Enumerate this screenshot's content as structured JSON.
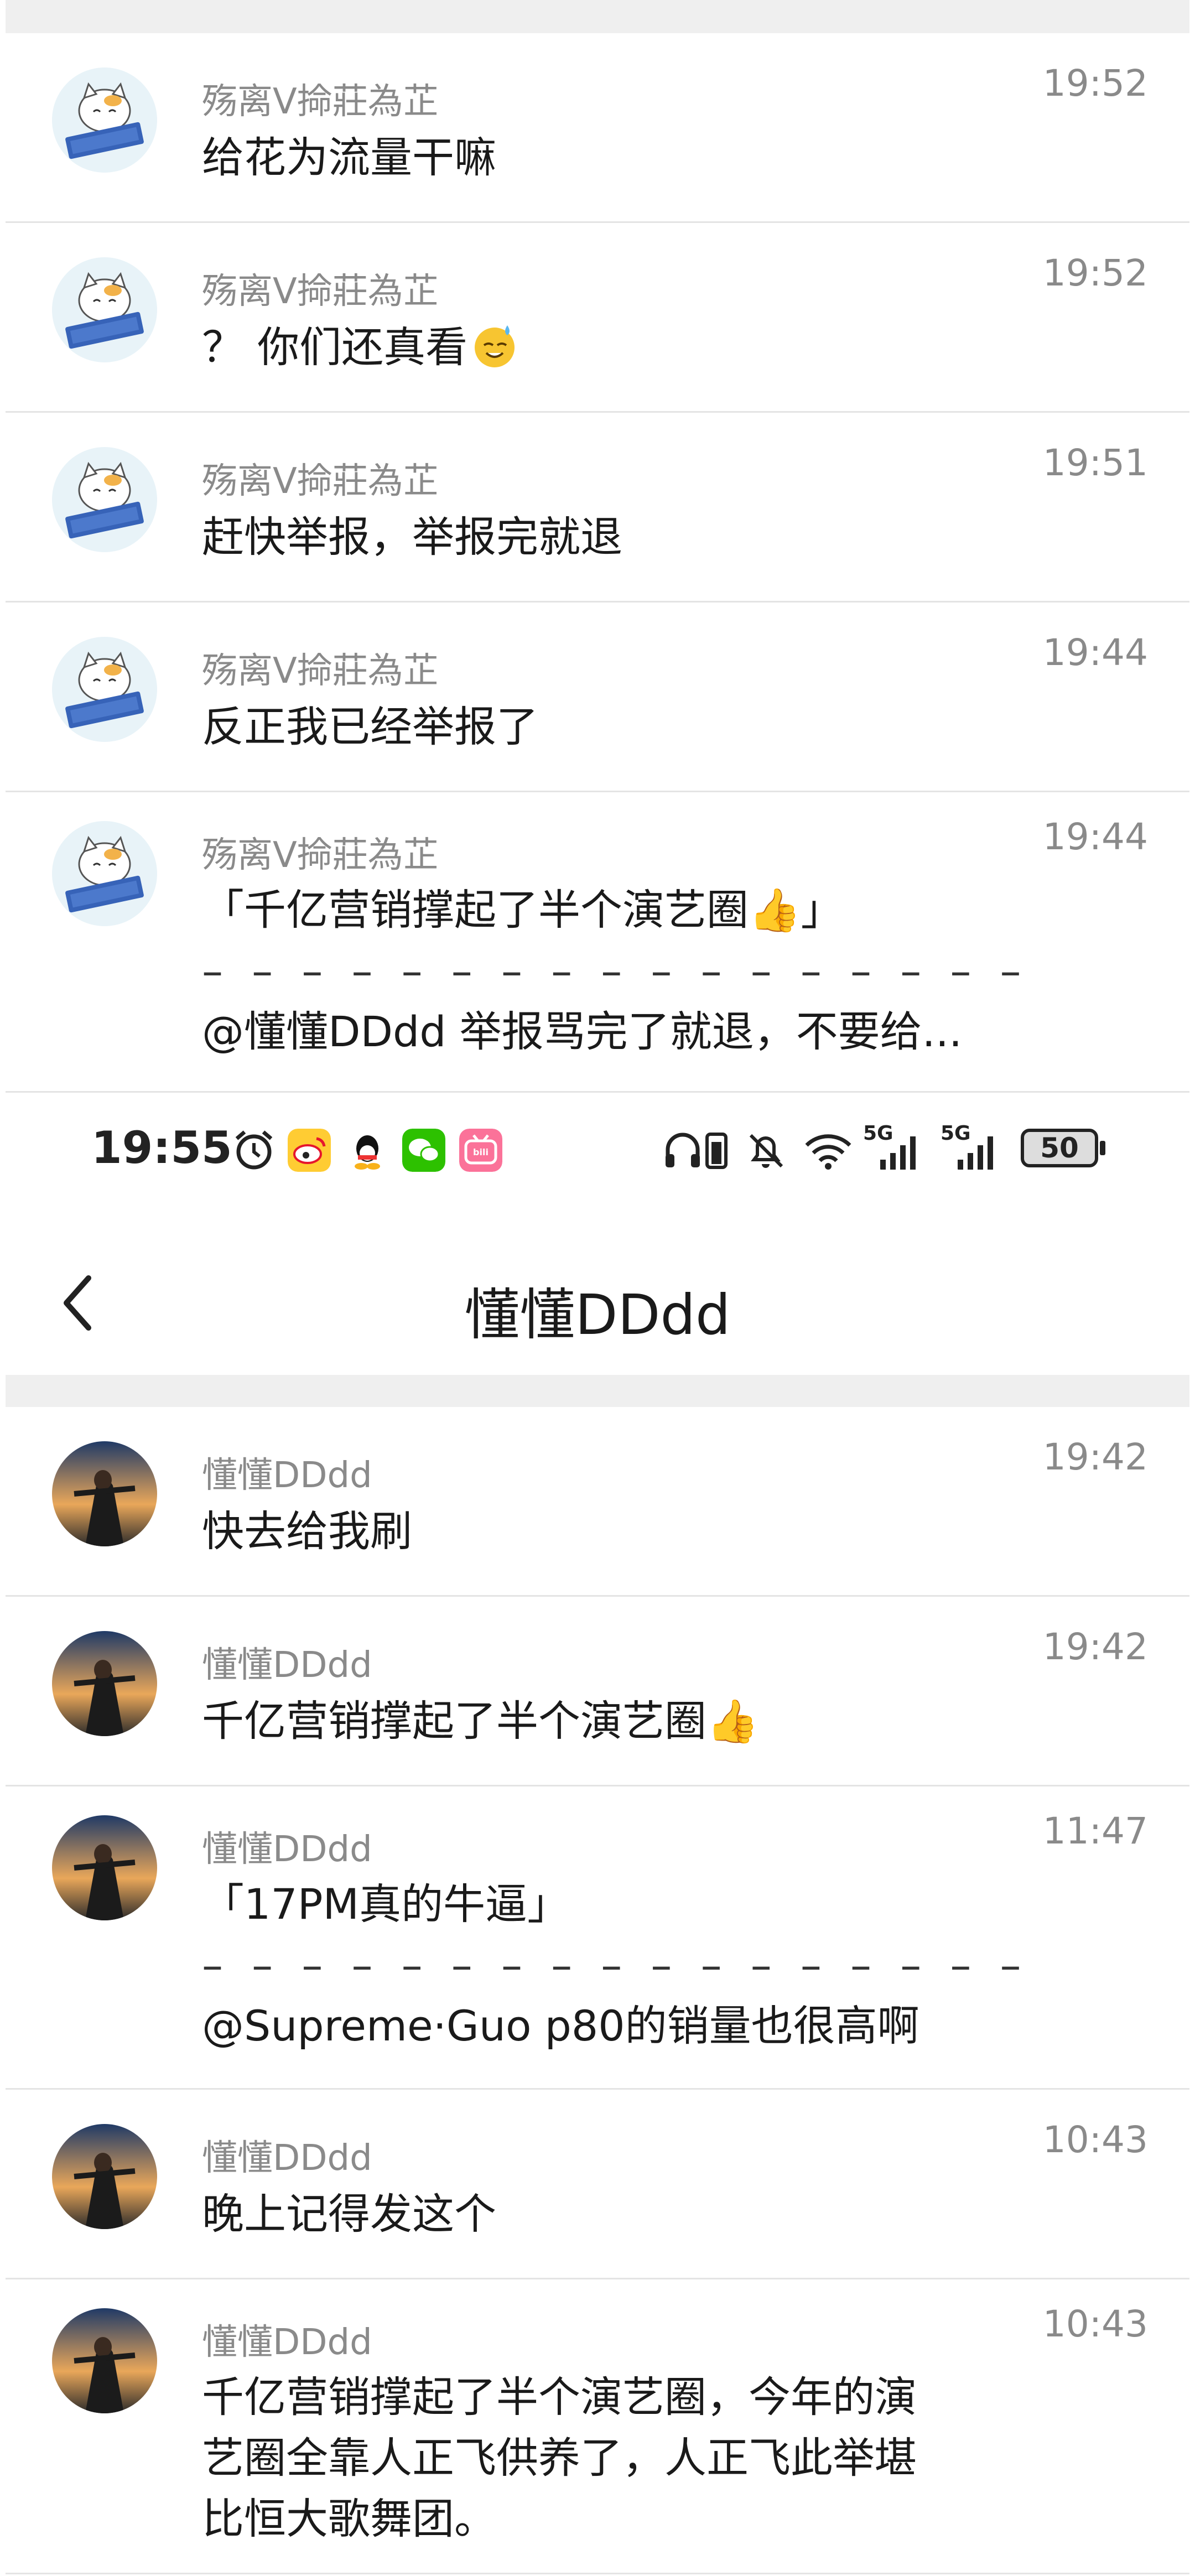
{
  "top_section": {
    "rows": [
      {
        "name": "殇离V掵莊為芷",
        "time": "19:52",
        "lines": [
          "给花为流量干嘛"
        ],
        "emoji": null
      },
      {
        "name": "殇离V掵莊為芷",
        "time": "19:52",
        "lines": [
          "？ 你们还真看"
        ],
        "emoji": "sweat-smile"
      },
      {
        "name": "殇离V掵莊為芷",
        "time": "19:51",
        "lines": [
          "赶快举报，举报完就退"
        ],
        "emoji": null
      },
      {
        "name": "殇离V掵莊為芷",
        "time": "19:44",
        "lines": [
          "反正我已经举报了"
        ],
        "emoji": null
      },
      {
        "name": "殇离V掵莊為芷",
        "time": "19:44",
        "quote": "「千亿营销撑起了半个演艺圈👍」",
        "dash": "– – – – – – – – – – – – – – – – –",
        "reply": "@懂懂DDdd 举报骂完了就退，不要给..."
      }
    ]
  },
  "status_bar": {
    "time": "19:55",
    "battery": "50",
    "network_1": "5G",
    "network_2": "5G"
  },
  "header": {
    "title": "懂懂DDdd",
    "back_label": "<"
  },
  "bottom_section": {
    "rows": [
      {
        "name": "懂懂DDdd",
        "time": "19:42",
        "lines": [
          "快去给我刷"
        ]
      },
      {
        "name": "懂懂DDdd",
        "time": "19:42",
        "lines": [
          "千亿营销撑起了半个演艺圈👍"
        ]
      },
      {
        "name": "懂懂DDdd",
        "time": "11:47",
        "quote": "「17PM真的牛逼」",
        "dash": "– – – – – – – – – – – – – – – – –",
        "reply": "@Supreme·Guo p80的销量也很高啊"
      },
      {
        "name": "懂懂DDdd",
        "time": "10:43",
        "lines": [
          "晚上记得发这个"
        ]
      },
      {
        "name": "懂懂DDdd",
        "time": "10:43",
        "lines": [
          "千亿营销撑起了半个演艺圈，今年的演",
          "艺圈全靠人正飞供养了，人正飞此举堪",
          "比恒大歌舞团。"
        ]
      }
    ]
  },
  "colors": {
    "separator": "#e4e4e4",
    "gray_bar": "#efefef",
    "secondary_text": "#8a8a8a",
    "primary_text": "#1a1a1a"
  }
}
